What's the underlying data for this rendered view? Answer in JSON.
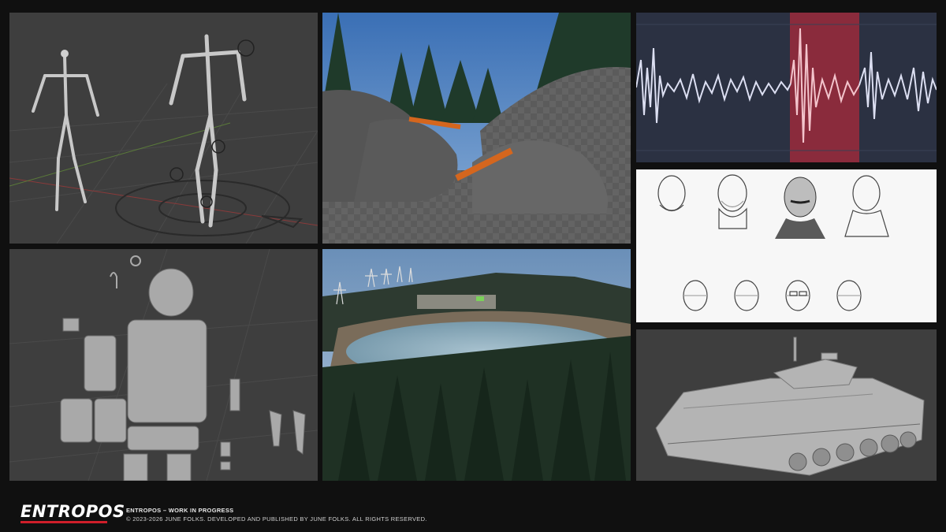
{
  "footer": {
    "logo": "ENTROPOS",
    "title": "ENTROPOS – WORK IN PROGRESS",
    "copyright": "© 2023-2026 JUNE FOLKS. DEVELOPED AND PUBLISHED BY JUNE FOLKS. ALL RIGHTS RESERVED."
  },
  "colors": {
    "background": "#101010",
    "viewport_grey": "#3d3d3d",
    "accent_red": "#d01e2a",
    "waveform_bg": "#2b3142",
    "waveform_highlight": "#8a2b3c"
  },
  "panels": [
    {
      "id": "rig-skeletons",
      "desc_icon": "skeleton-rig-icon"
    },
    {
      "id": "terrain-blockout",
      "desc_icon": "terrain-icon"
    },
    {
      "id": "audio-waveform",
      "desc_icon": "waveform-icon"
    },
    {
      "id": "character-sketches",
      "desc_icon": "sketch-icon"
    },
    {
      "id": "gear-model",
      "desc_icon": "gear-model-icon"
    },
    {
      "id": "lake-landscape",
      "desc_icon": "landscape-icon"
    },
    {
      "id": "ifv-vehicle",
      "desc_icon": "vehicle-icon"
    }
  ]
}
